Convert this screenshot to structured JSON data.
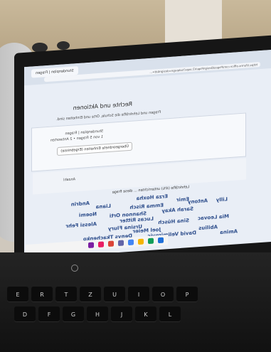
{
  "browser": {
    "tab_label": "Stundenplan | Fragen",
    "url_text": "https://forms.office.com/Pages/DesignPageV2.aspx?subpage=design&id=..."
  },
  "page": {
    "heading": "Rechte und Aktionen",
    "subheading": "Fragen und Lehrkräfte die Schule, Orte und Einheiten sind.",
    "card_line_1": "Stundenplan | Fragen",
    "card_line_2": "1 von 5 Fragen • 2 Antworten",
    "chip_label": "Übergeordnete Einheiten (Ergebnisse)",
    "slot_label": "Anzahl",
    "footnote": "Lehrkräfte (4%) unterrichten ... diese Frage"
  },
  "names": [
    "Erza Hoxha",
    "Emir",
    "Lilly",
    "Antony",
    "Liana",
    "Andrin",
    "Emma Risch",
    "Sarah Akay",
    "Shannon Orti",
    "Noemi",
    "Lucas Ritter",
    "Mia Leovac",
    "Sina Hüsch",
    "Alessi Fehr",
    "Ursina Flury",
    "Joel Meier",
    "Abilius",
    "David Velimirovic",
    "Amina",
    "Denys Tkachenko"
  ],
  "keyboard": {
    "row1": [
      "E",
      "R",
      "T",
      "Z",
      "U",
      "I",
      "O",
      "P"
    ],
    "row2": [
      "D",
      "F",
      "G",
      "H",
      "J",
      "K",
      "L"
    ]
  },
  "colors": {
    "screen_bg": "#e9eef6",
    "name_text": "#2e4e8c",
    "laptop_body": "#161616"
  }
}
